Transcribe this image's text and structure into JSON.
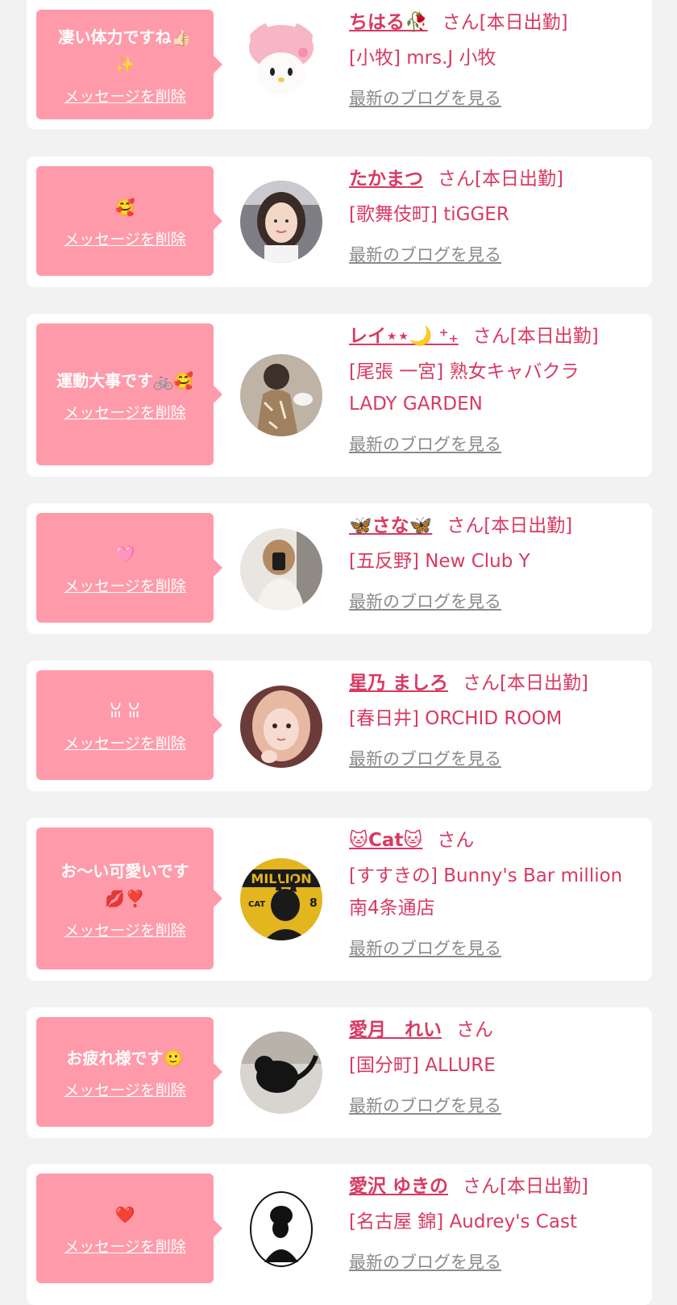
{
  "cards": [
    {
      "message": "凄い体力ですね👍🏻\n✨",
      "delete_label": "メッセージを削除",
      "name": "ちはる🥀",
      "san": "さん[本日出勤]",
      "shop": "[小牧] mrs.J 小牧",
      "blog_label": "最新のブログを見る",
      "avatar": "pink-plush-avatar"
    },
    {
      "message": "🥰",
      "delete_label": "メッセージを削除",
      "name": "たかまつ",
      "san": "さん[本日出勤]",
      "shop": "[歌舞伎町] tiGGER",
      "blog_label": "最新のブログを見る",
      "avatar": "girl-photo-avatar"
    },
    {
      "message": "運動大事です🚲🥰",
      "delete_label": "メッセージを削除",
      "name": "レイ⋆⋆🌙 ⁺₊",
      "san": "さん[本日出勤]",
      "shop": "[尾張 一宮] 熟女キャバクラ LADY GARDEN",
      "blog_label": "最新のブログを見る",
      "avatar": "dress-back-avatar"
    },
    {
      "message": "🩷",
      "delete_label": "メッセージを削除",
      "name": "🦋さな🦋",
      "san": "さん[本日出勤]",
      "shop": "[五反野] New Club Y",
      "blog_label": "最新のブログを見る",
      "avatar": "mirror-selfie-avatar"
    },
    {
      "message": "ꈍ ꈍ",
      "delete_label": "メッセージを削除",
      "name": "星乃 ましろ",
      "san": "さん[本日出勤]",
      "shop": "[春日井] ORCHID ROOM",
      "blog_label": "最新のブログを見る",
      "avatar": "pink-hair-avatar"
    },
    {
      "message": "お〜い可愛いです\n💋❣️",
      "delete_label": "メッセージを削除",
      "name": "🐱Cat🐱",
      "san": "さん",
      "shop": "[すすきの] Bunny's Bar million 南4条通店",
      "blog_label": "最新のブログを見る",
      "avatar": "million-cat-avatar"
    },
    {
      "message": "お疲れ様です🙂",
      "delete_label": "メッセージを削除",
      "name": "愛月　れい",
      "san": "さん",
      "shop": "[国分町] ALLURE",
      "blog_label": "最新のブログを見る",
      "avatar": "black-cat-avatar"
    },
    {
      "message": "❤️",
      "delete_label": "メッセージを削除",
      "name": "愛沢 ゆきの",
      "san": "さん[本日出勤]",
      "shop": "[名古屋 錦] Audrey's Cast",
      "blog_label": "最新のブログを見る",
      "avatar": "audrey-logo-avatar"
    }
  ]
}
